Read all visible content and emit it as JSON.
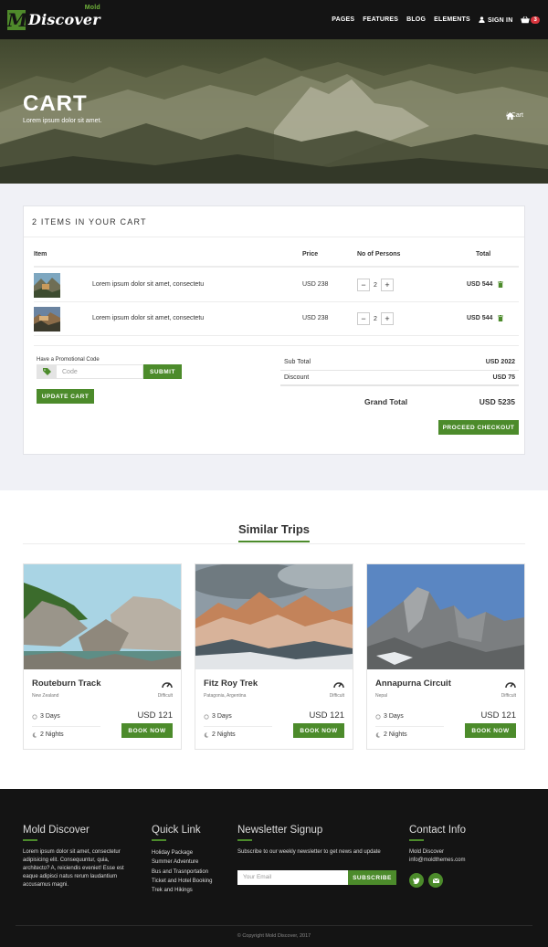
{
  "brand": {
    "name": "Discover",
    "tag": "Mold",
    "mark": "M"
  },
  "nav": {
    "items": [
      "PAGES",
      "FEATURES",
      "BLOG",
      "ELEMENTS"
    ],
    "signin": "SIGN IN",
    "cart_count": "3"
  },
  "hero": {
    "title": "CART",
    "subtitle": "Lorem ipsum dolor sit amet.",
    "breadcrumb_current": "Cart",
    "breadcrumb_sep": "/"
  },
  "cart": {
    "heading": "2 ITEMS IN YOUR CART",
    "columns": {
      "item": "Item",
      "price": "Price",
      "persons": "No of Persons",
      "total": "Total"
    },
    "rows": [
      {
        "name": "Lorem ipsum dolor sit amet, consectetu",
        "price": "USD 238",
        "qty": "2",
        "total": "USD 544"
      },
      {
        "name": "Lorem ipsum dolor sit amet, consectetu",
        "price": "USD 238",
        "qty": "2",
        "total": "USD 544"
      }
    ],
    "qty_minus": "−",
    "qty_plus": "+",
    "promo_label": "Have a Promotional Code",
    "promo_placeholder": "Code",
    "submit": "SUBMIT",
    "update": "UPDATE CART",
    "subtotal_label": "Sub Total",
    "subtotal": "USD 2022",
    "discount_label": "Discount",
    "discount": "USD 75",
    "grand_label": "Grand Total",
    "grand": "USD 5235",
    "proceed": "PROCEED CHECKOUT"
  },
  "similar": {
    "title": "Similar Trips",
    "trips": [
      {
        "name": "Routeburn Track",
        "location": "New Zealand",
        "difficulty": "Difficult",
        "days": "3 Days",
        "nights": "2 Nights",
        "price": "USD 121",
        "cta": "BOOK NOW"
      },
      {
        "name": "Fitz Roy Trek",
        "location": "Patagonia, Argentina",
        "difficulty": "Difficult",
        "days": "3 Days",
        "nights": "2 Nights",
        "price": "USD 121",
        "cta": "BOOK NOW"
      },
      {
        "name": "Annapurna Circuit",
        "location": "Nepal",
        "difficulty": "Difficult",
        "days": "3 Days",
        "nights": "2 Nights",
        "price": "USD 121",
        "cta": "BOOK NOW"
      }
    ]
  },
  "footer": {
    "about_title": "Mold Discover",
    "about_text": "Lorem ipsum dolor sit amet, consectetur adipisicing elit. Consequuntur, quia, architecto? A, reiciendis eveniet! Esse est eaque adipisci natus rerum laudantium accusamus magni.",
    "links_title": "Quick Link",
    "links": [
      "Holiday Package",
      "Summer Adventure",
      "Bus and Trasnportation",
      "Ticket and Hotel Booking",
      "Trek and Hikings"
    ],
    "news_title": "Newsletter Signup",
    "news_text": "Subscribe to our weekly newsletter to get news and update",
    "news_placeholder": "Your Email",
    "news_button": "SUBSCRIBE",
    "contact_title": "Contact Info",
    "contact_name": "Mold Discover",
    "contact_email": "info@moldthemes.com",
    "copyright": "© Copyright Mold Discover, 2017"
  },
  "colors": {
    "accent": "#4c8b2b",
    "dark": "#141414",
    "badge": "#d9363e",
    "panel_bg": "#f0f1f6"
  }
}
